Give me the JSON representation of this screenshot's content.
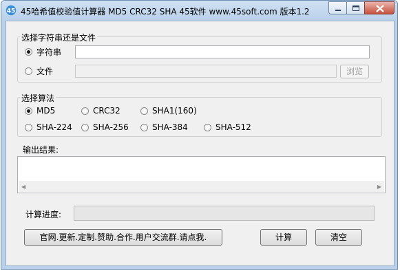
{
  "window": {
    "title": "45哈希值校验值计算器 MD5 CRC32 SHA 45软件 www.45soft.com 版本1.2",
    "icon": "45soft-app-icon",
    "controls": [
      "minimize-icon",
      "maximize-icon",
      "close-icon"
    ]
  },
  "source_group": {
    "title": "选择字符串还是文件",
    "options": [
      {
        "label": "字符串",
        "selected": true
      },
      {
        "label": "文件",
        "selected": false
      }
    ],
    "string_value": "",
    "file_value": "",
    "browse_label": "浏览"
  },
  "algo_group": {
    "title": "选择算法",
    "options": [
      {
        "label": "MD5",
        "selected": true
      },
      {
        "label": "CRC32",
        "selected": false
      },
      {
        "label": "SHA1(160)",
        "selected": false
      },
      {
        "label": "SHA-224",
        "selected": false
      },
      {
        "label": "SHA-256",
        "selected": false
      },
      {
        "label": "SHA-384",
        "selected": false
      },
      {
        "label": "SHA-512",
        "selected": false
      }
    ]
  },
  "output": {
    "label": "输出结果:",
    "value": ""
  },
  "progress": {
    "label": "计算进度:",
    "value": 0
  },
  "buttons": {
    "website": "官网.更新.定制.赞助.合作.用户交流群.请点我.",
    "compute": "计算",
    "clear": "清空"
  }
}
